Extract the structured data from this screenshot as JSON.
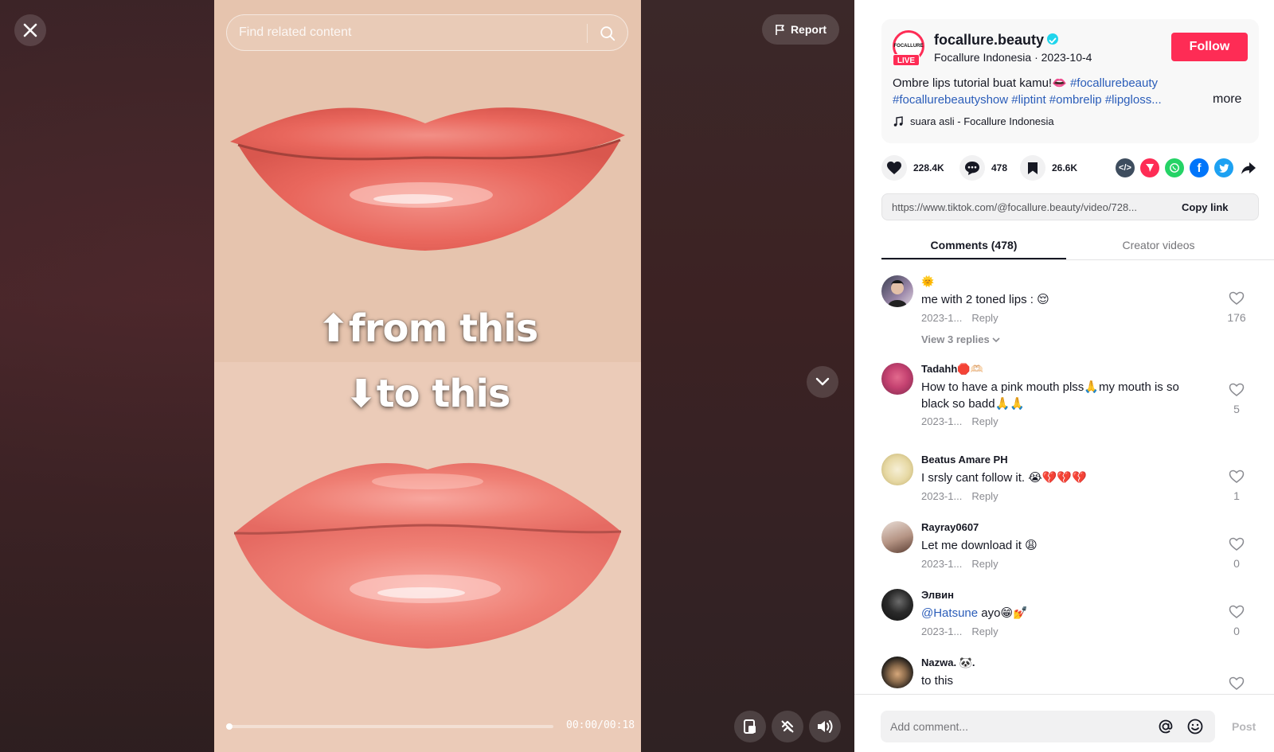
{
  "video": {
    "search_placeholder": "Find related content",
    "report_label": "Report",
    "caption_top": "⬆from this",
    "caption_bottom": "⬇to this",
    "time": "00:00/00:18",
    "progress_fraction": 0.0
  },
  "author": {
    "username": "focallure.beauty",
    "display_line": "Focallure Indonesia · 2023-10-4",
    "live_badge": "LIVE",
    "avatar_text": "FOCALLURE",
    "follow_label": "Follow"
  },
  "post": {
    "desc_text": "Ombre lips tutorial buat kamu!👄 ",
    "tags_line1": "#focallurebeauty",
    "tags_line2": "#focallurebeautyshow #liptint #ombrelip #lipgloss...",
    "more_label": "more",
    "music": "suara asli - Focallure Indonesia"
  },
  "stats": {
    "likes": "228.4K",
    "comments": "478",
    "saves": "26.6K"
  },
  "share": {
    "link": "https://www.tiktok.com/@focallure.beauty/video/728...",
    "copy_label": "Copy link"
  },
  "tabs": {
    "comments": "Comments (478)",
    "creator": "Creator videos"
  },
  "comments": [
    {
      "name": "🌞",
      "text": "me with 2 toned lips : 😌",
      "date": "2023-1...",
      "reply": "Reply",
      "likes": "176",
      "view_replies": "View 3 replies"
    },
    {
      "name": "Tadahh🛑🫶🏻",
      "text": "How to have a pink mouth plss🙏my mouth is so black so badd🙏🙏",
      "date": "2023-1...",
      "reply": "Reply",
      "likes": "5"
    },
    {
      "name": "Beatus Amare PH",
      "text": "I srsly cant follow it. 😭💔💔💔",
      "date": "2023-1...",
      "reply": "Reply",
      "likes": "1"
    },
    {
      "name": "Rayray0607",
      "text": "Let me download it 😩",
      "date": "2023-1...",
      "reply": "Reply",
      "likes": "0"
    },
    {
      "name": "Элвин",
      "mention": "@Hatsune",
      "text": " ayo😁💅",
      "date": "2023-1...",
      "reply": "Reply",
      "likes": "0"
    },
    {
      "name": "Nazwa. 🐼.",
      "text": "to this",
      "date": "",
      "reply": "",
      "likes": ""
    }
  ],
  "composer": {
    "placeholder": "Add comment...",
    "post_label": "Post"
  },
  "colors": {
    "brand": "#fe2c55",
    "link": "#2b5db9"
  }
}
